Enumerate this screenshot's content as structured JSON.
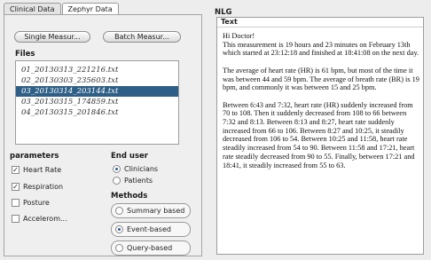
{
  "tabs": [
    "Clinical Data",
    "Zephyr Data"
  ],
  "buttons": {
    "single": "Single Measur...",
    "batch": "Batch Measur..."
  },
  "files": {
    "label": "Files",
    "items": [
      "01_20130313_221216.txt",
      "02_20130303_235603.txt",
      "03_20130314_203144.txt",
      "03_20130315_174859.txt",
      "04_20130315_201846.txt"
    ],
    "selected_index": 2
  },
  "parameters": {
    "label": "parameters",
    "items": [
      {
        "label": "Heart Rate",
        "checked": true
      },
      {
        "label": "Respiration",
        "checked": true
      },
      {
        "label": "Posture",
        "checked": false
      },
      {
        "label": "Accelerom...",
        "checked": false
      }
    ]
  },
  "end_user": {
    "label": "End user",
    "options": [
      {
        "label": "Clinicians",
        "selected": true
      },
      {
        "label": "Patients",
        "selected": false
      }
    ]
  },
  "methods": {
    "label": "Methods",
    "options": [
      {
        "label": "Summary based",
        "selected": false
      },
      {
        "label": "Event-based",
        "selected": true
      },
      {
        "label": "Query-based",
        "selected": false
      }
    ]
  },
  "nlg": {
    "title": "NLG",
    "header": "Text",
    "paragraphs": [
      "Hi Doctor!\nThis measurement is 19 hours and 23 minutes on February 13th which started at 23:12:18 and finished at 18:41:08 on the next day.",
      "The average of heart rate (HR) is 61 bpm, but most of the time it was between 44 and 59 bpm. The average of breath rate (BR) is 19 bpm, and commonly it was between 15 and 25 bpm.",
      "Between 6:43 and 7:32, heart rate (HR) suddenly increased from 70 to 108. Then it suddenly decreased from 108 to 66 between 7:32 and 8:13. Between 8:13 and 8:27, heart rate suddenly increased from 66 to 106. Between 8:27 and 10:25, it steadily decreased from 106 to 54. Between 10:25 and 11:58, heart rate steadily increased from 54 to 90. Between 11:58 and 17:21, heart rate steadily decreased from 90 to 55. Finally, between 17:21 and 18:41, it steadily increased from 55 to 63."
    ]
  }
}
